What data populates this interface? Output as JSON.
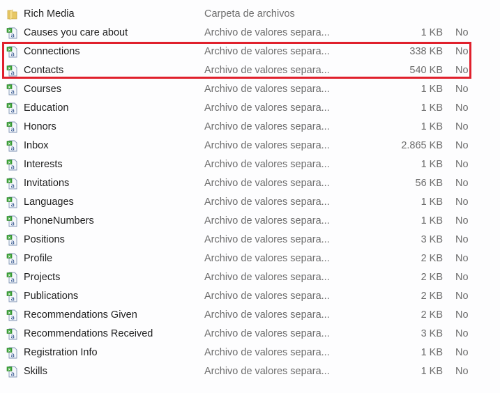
{
  "colors": {
    "highlight": "#e0202c"
  },
  "files": [
    {
      "icon": "folder-icon",
      "name": "Rich Media",
      "type": "Carpeta de archivos",
      "size": "",
      "available": ""
    },
    {
      "icon": "csv-file-icon",
      "name": "Causes you care about",
      "type": "Archivo de valores separa...",
      "size": "1 KB",
      "available": "No"
    },
    {
      "icon": "csv-file-icon",
      "name": "Connections",
      "type": "Archivo de valores separa...",
      "size": "338 KB",
      "available": "No"
    },
    {
      "icon": "csv-file-icon",
      "name": "Contacts",
      "type": "Archivo de valores separa...",
      "size": "540 KB",
      "available": "No"
    },
    {
      "icon": "csv-file-icon",
      "name": "Courses",
      "type": "Archivo de valores separa...",
      "size": "1 KB",
      "available": "No"
    },
    {
      "icon": "csv-file-icon",
      "name": "Education",
      "type": "Archivo de valores separa...",
      "size": "1 KB",
      "available": "No"
    },
    {
      "icon": "csv-file-icon",
      "name": "Honors",
      "type": "Archivo de valores separa...",
      "size": "1 KB",
      "available": "No"
    },
    {
      "icon": "csv-file-icon",
      "name": "Inbox",
      "type": "Archivo de valores separa...",
      "size": "2.865 KB",
      "available": "No"
    },
    {
      "icon": "csv-file-icon",
      "name": "Interests",
      "type": "Archivo de valores separa...",
      "size": "1 KB",
      "available": "No"
    },
    {
      "icon": "csv-file-icon",
      "name": "Invitations",
      "type": "Archivo de valores separa...",
      "size": "56 KB",
      "available": "No"
    },
    {
      "icon": "csv-file-icon",
      "name": "Languages",
      "type": "Archivo de valores separa...",
      "size": "1 KB",
      "available": "No"
    },
    {
      "icon": "csv-file-icon",
      "name": "PhoneNumbers",
      "type": "Archivo de valores separa...",
      "size": "1 KB",
      "available": "No"
    },
    {
      "icon": "csv-file-icon",
      "name": "Positions",
      "type": "Archivo de valores separa...",
      "size": "3 KB",
      "available": "No"
    },
    {
      "icon": "csv-file-icon",
      "name": "Profile",
      "type": "Archivo de valores separa...",
      "size": "2 KB",
      "available": "No"
    },
    {
      "icon": "csv-file-icon",
      "name": "Projects",
      "type": "Archivo de valores separa...",
      "size": "2 KB",
      "available": "No"
    },
    {
      "icon": "csv-file-icon",
      "name": "Publications",
      "type": "Archivo de valores separa...",
      "size": "2 KB",
      "available": "No"
    },
    {
      "icon": "csv-file-icon",
      "name": "Recommendations Given",
      "type": "Archivo de valores separa...",
      "size": "2 KB",
      "available": "No"
    },
    {
      "icon": "csv-file-icon",
      "name": "Recommendations Received",
      "type": "Archivo de valores separa...",
      "size": "3 KB",
      "available": "No"
    },
    {
      "icon": "csv-file-icon",
      "name": "Registration Info",
      "type": "Archivo de valores separa...",
      "size": "1 KB",
      "available": "No"
    },
    {
      "icon": "csv-file-icon",
      "name": "Skills",
      "type": "Archivo de valores separa...",
      "size": "1 KB",
      "available": "No"
    }
  ]
}
